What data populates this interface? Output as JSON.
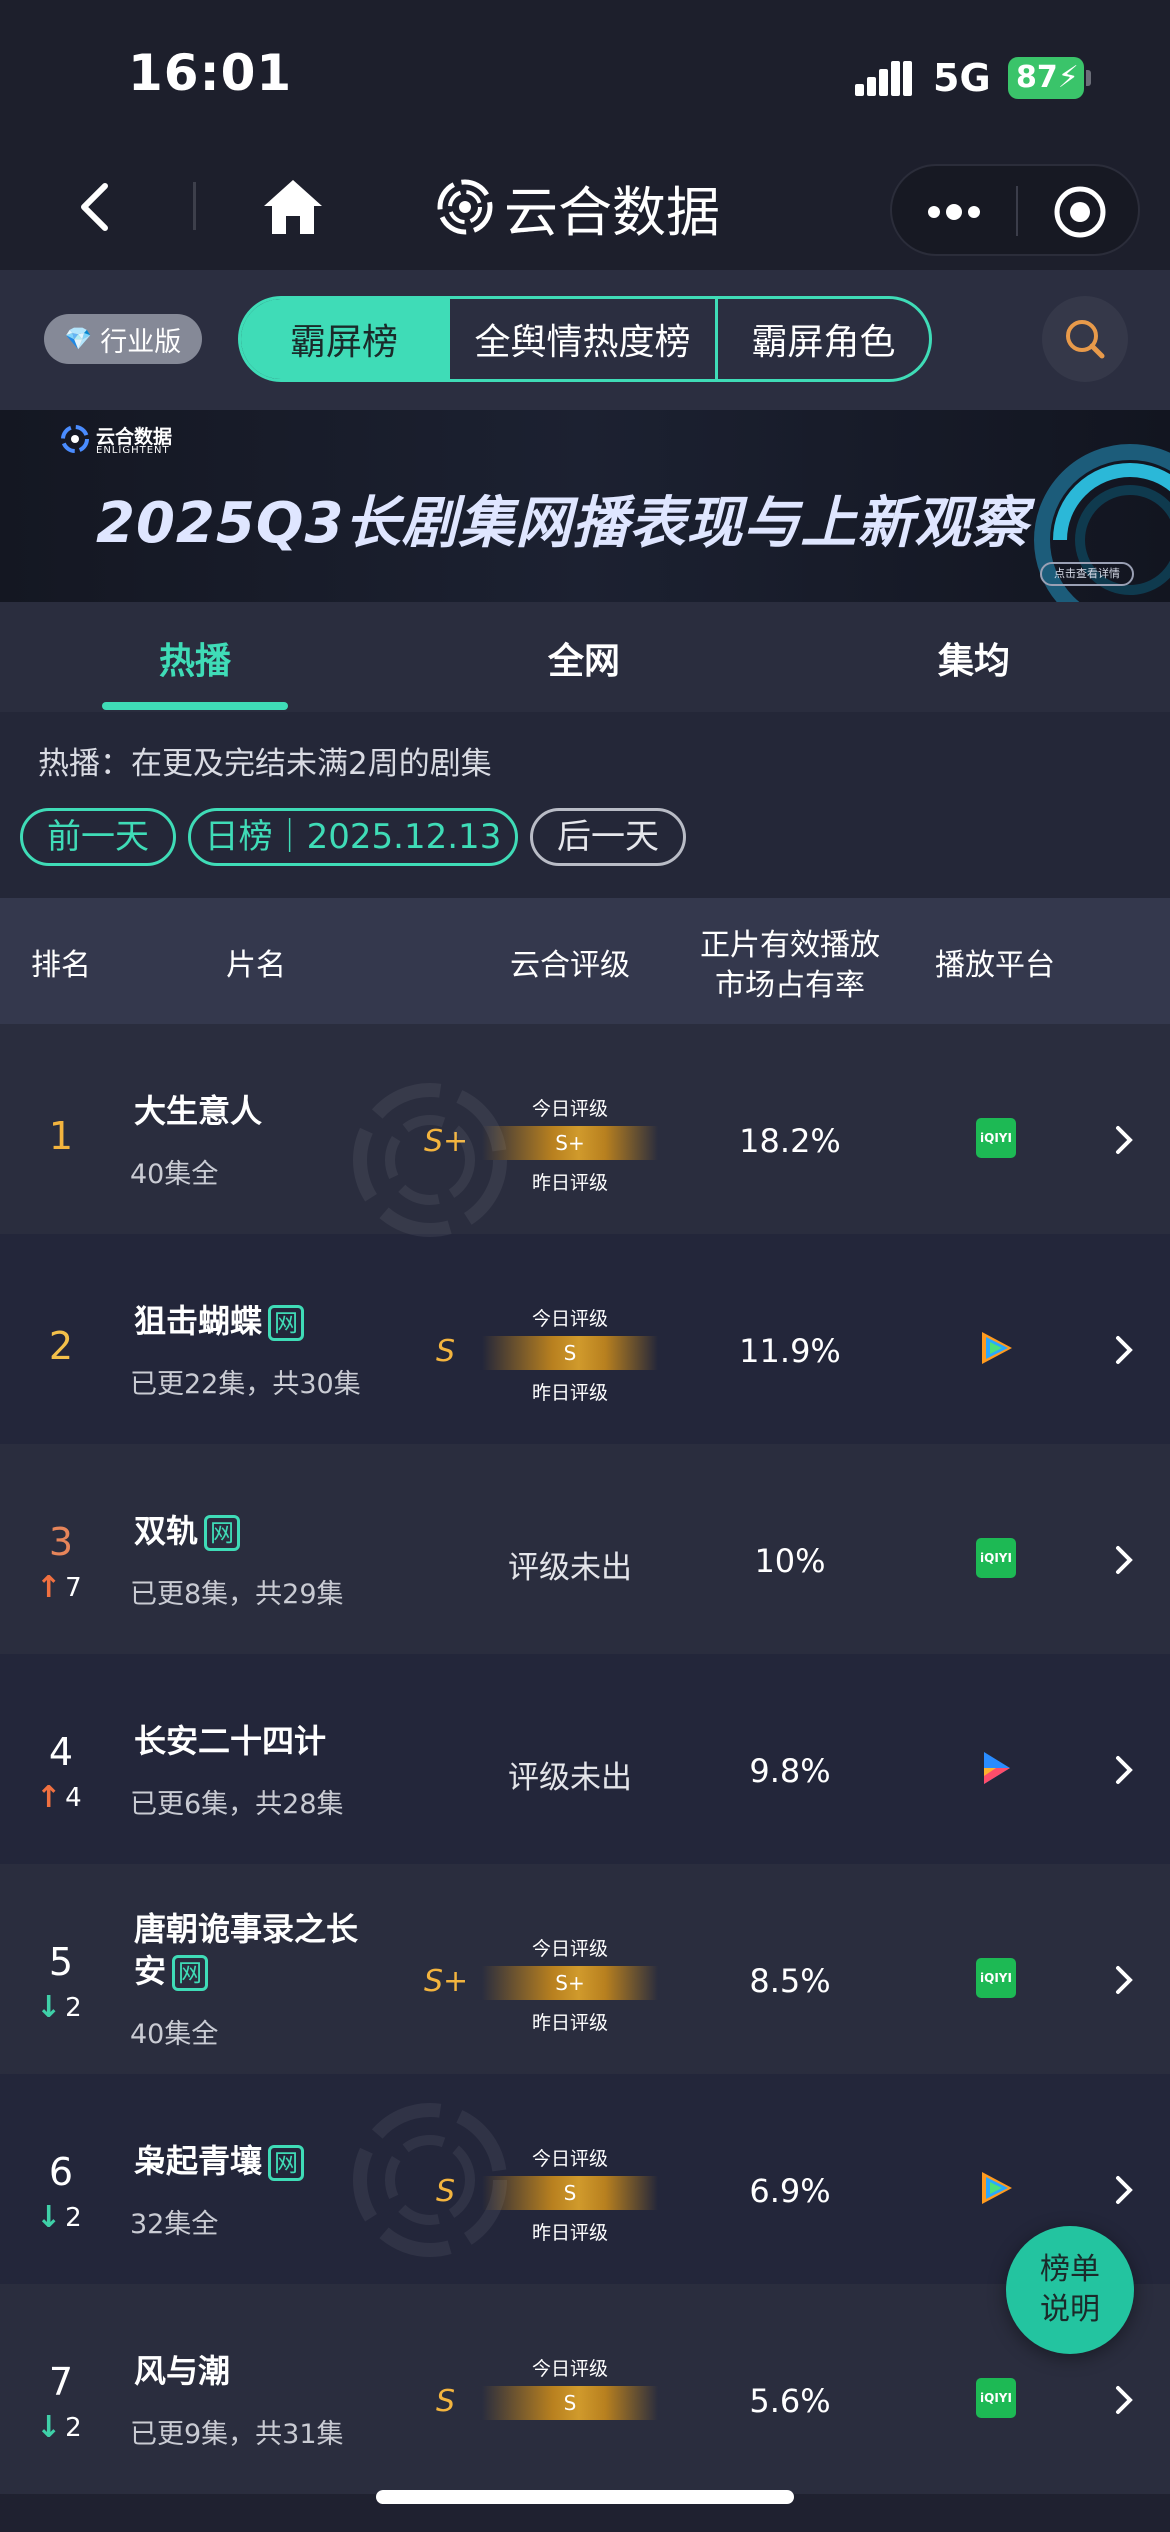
{
  "status_bar": {
    "time": "16:01",
    "network": "5G",
    "battery": "87"
  },
  "nav": {
    "brand": "云合数据"
  },
  "tabs": {
    "industry_label": "行业版",
    "segments": [
      "霸屏榜",
      "全舆情热度榜",
      "霸屏角色"
    ]
  },
  "banner": {
    "logo_cn": "云合数据",
    "logo_en": "ENLIGHTENT",
    "title": "2025Q3长剧集网播表现与上新观察",
    "button": "点击查看详情"
  },
  "subtabs": [
    "热播",
    "全网",
    "集均"
  ],
  "info": {
    "description": "热播：在更及完结未满2周的剧集",
    "prev_day": "前一天",
    "date_label": "日榜｜2025.12.13",
    "next_day": "后一天"
  },
  "table": {
    "headers": {
      "rank": "排名",
      "name": "片名",
      "grade": "云合评级",
      "share_line1": "正片有效播放",
      "share_line2": "市场占有率",
      "platform": "播放平台"
    },
    "today_grade_label": "今日评级",
    "yesterday_grade_label": "昨日评级",
    "rows": [
      {
        "rank": "1",
        "change": "",
        "title": "大生意人",
        "net": false,
        "episodes": "40集全",
        "grade": "S+",
        "grade_bar": "S+",
        "share": "18.2%",
        "platform": "iqiyi"
      },
      {
        "rank": "2",
        "change": "",
        "title": "狙击蝴蝶",
        "net": true,
        "episodes": "已更22集，共30集",
        "grade": "S",
        "grade_bar": "S",
        "share": "11.9%",
        "platform": "tencent-video"
      },
      {
        "rank": "3",
        "change": "7",
        "direction": "up",
        "title": "双轨",
        "net": true,
        "episodes": "已更8集，共29集",
        "grade": "评级未出",
        "share": "10%",
        "platform": "iqiyi"
      },
      {
        "rank": "4",
        "change": "4",
        "direction": "up",
        "title": "长安二十四计",
        "net": false,
        "episodes": "已更6集，共28集",
        "grade": "评级未出",
        "share": "9.8%",
        "platform": "youku"
      },
      {
        "rank": "5",
        "change": "2",
        "direction": "down",
        "title_line1": "唐朝诡事录之长",
        "title_line2": "安",
        "net": true,
        "episodes": "40集全",
        "grade": "S+",
        "grade_bar": "S+",
        "share": "8.5%",
        "platform": "iqiyi"
      },
      {
        "rank": "6",
        "change": "2",
        "direction": "down",
        "title": "枭起青壤",
        "net": true,
        "episodes": "32集全",
        "grade": "S",
        "grade_bar": "S",
        "share": "6.9%",
        "platform": "tencent-video"
      },
      {
        "rank": "7",
        "change": "2",
        "direction": "down",
        "title": "风与潮",
        "net": false,
        "episodes": "已更9集，共31集",
        "grade": "S",
        "grade_bar": "S",
        "share": "5.6%",
        "platform": "iqiyi"
      }
    ],
    "net_badge": "网"
  },
  "float_button": {
    "line1": "榜单",
    "line2": "说明"
  },
  "icons": {
    "back": "chevron-left-icon",
    "home": "home-icon",
    "more": "more-dots-icon",
    "target": "target-icon",
    "search": "search-icon",
    "diamond": "diamond-icon",
    "chevron": "chevron-right-icon"
  },
  "colors": {
    "accent": "#3fdcb7",
    "gold": "#f3b43e",
    "up": "#f07040",
    "down": "#3fd0a8",
    "background": "#1f2130"
  }
}
